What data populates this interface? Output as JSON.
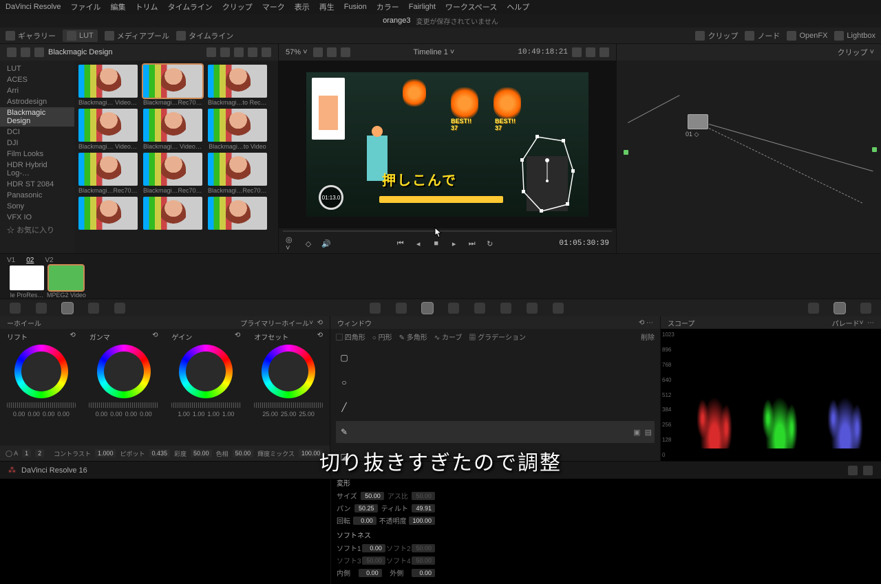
{
  "app": "DaVinci Resolve",
  "menu": [
    "ファイル",
    "編集",
    "トリム",
    "タイムライン",
    "クリップ",
    "マーク",
    "表示",
    "再生",
    "Fusion",
    "カラー",
    "Fairlight",
    "ワークスペース",
    "ヘルプ"
  ],
  "toolbar": {
    "gallery": "ギャラリー",
    "lut": "LUT",
    "media": "メディアプール",
    "timeline": "タイムライン",
    "clip": "クリップ",
    "nodes": "ノード",
    "openfx": "OpenFX",
    "lightbox": "Lightbox"
  },
  "project": {
    "name": "orange3",
    "modified": "変更が保存されていません"
  },
  "luts": {
    "title": "Blackmagic Design",
    "tree": [
      "LUT",
      "ACES",
      "Arri",
      "Astrodesign",
      "Blackmagic Design",
      "DCI",
      "DJI",
      "Film Looks",
      "HDR Hybrid Log-…",
      "HDR ST 2084",
      "Panasonic",
      "Sony",
      "VFX IO",
      "お気に入り"
    ],
    "tree_sel": 4,
    "grid": [
      [
        "Blackmagi… Video v4",
        "Blackmagi…Rec709 v3",
        "Blackmagi…to Rec709"
      ],
      [
        "Blackmagi… Video v3",
        "Blackmagi… Video v4",
        "Blackmagi…to Video"
      ],
      [
        "Blackmagi…Rec709 v2",
        "Blackmagi…Rec709 v2",
        "Blackmagi…Rec709 v2"
      ],
      [
        "",
        "",
        ""
      ]
    ],
    "selected": [
      0,
      1
    ]
  },
  "viewer": {
    "zoom": "57%",
    "timeline": "Timeline 1",
    "tc_top": "10:49:18:21",
    "timer": "01:13.0",
    "best": "BEST!!",
    "best_score": "37",
    "title_text": "押しこんで",
    "tc_bottom": "01:05:30:39",
    "node": {
      "clip": "クリップ",
      "label": "01"
    }
  },
  "thumbs": {
    "v1": "V1",
    "v2": "02",
    "v3": "V2",
    "t1": "le ProRes…",
    "t2": "MPEG2 Video"
  },
  "wheels": {
    "hdr": "ーホイール",
    "mode": "プライマリーホイール",
    "labels": [
      "リフト",
      "ガンマ",
      "ゲイン",
      "オフセット"
    ],
    "vals": {
      "lift": [
        "0.00",
        "0.00",
        "0.00",
        "0.00"
      ],
      "gamma": [
        "0.00",
        "0.00",
        "0.00",
        "0.00"
      ],
      "gain": [
        "1.00",
        "1.00",
        "1.00",
        "1.00"
      ],
      "offset": [
        "25.00",
        "25.00",
        "25.00"
      ]
    },
    "foot": {
      "contrast": "コントラスト",
      "contrast_v": "1.000",
      "pivot": "ピボット",
      "pivot_v": "0.435",
      "sat": "彩度",
      "sat_v": "50.00",
      "hue": "色相",
      "hue_v": "50.00",
      "lummix": "輝度ミックス",
      "lummix_v": "100.00"
    }
  },
  "window": {
    "hdr": "ウィンドウ",
    "tools": [
      "四角形",
      "円形",
      "多角形",
      "カーブ",
      "グラデーション"
    ],
    "delete": "削除"
  },
  "params": {
    "transform": "変形",
    "size": "サイズ",
    "size_v": "50.00",
    "aspect": "アス比",
    "aspect_v": "50.00",
    "pan": "パン",
    "pan_v": "50.25",
    "tilt": "ティルト",
    "tilt_v": "49.91",
    "rotate": "回転",
    "rotate_v": "0.00",
    "opacity": "不透明度",
    "opacity_v": "100.00",
    "softness": "ソフトネス",
    "soft1": "ソフト1",
    "soft1_v": "0.00",
    "soft2": "ソフト2",
    "soft2_v": "50.00",
    "soft3": "ソフト3",
    "soft3_v": "50.00",
    "soft4": "ソフト4",
    "soft4_v": "50.00",
    "inside": "内側",
    "inside_v": "0.00",
    "outside": "外側",
    "outside_v": "0.00"
  },
  "scopes": {
    "hdr": "スコープ",
    "mode": "パレード",
    "yaxis": [
      "1023",
      "896",
      "768",
      "640",
      "512",
      "384",
      "256",
      "128",
      "0"
    ]
  },
  "statusbar": {
    "app": "DaVinci Resolve 16",
    "nums": [
      "1",
      "2"
    ]
  },
  "subtitle": "切り抜きすぎたので調整"
}
